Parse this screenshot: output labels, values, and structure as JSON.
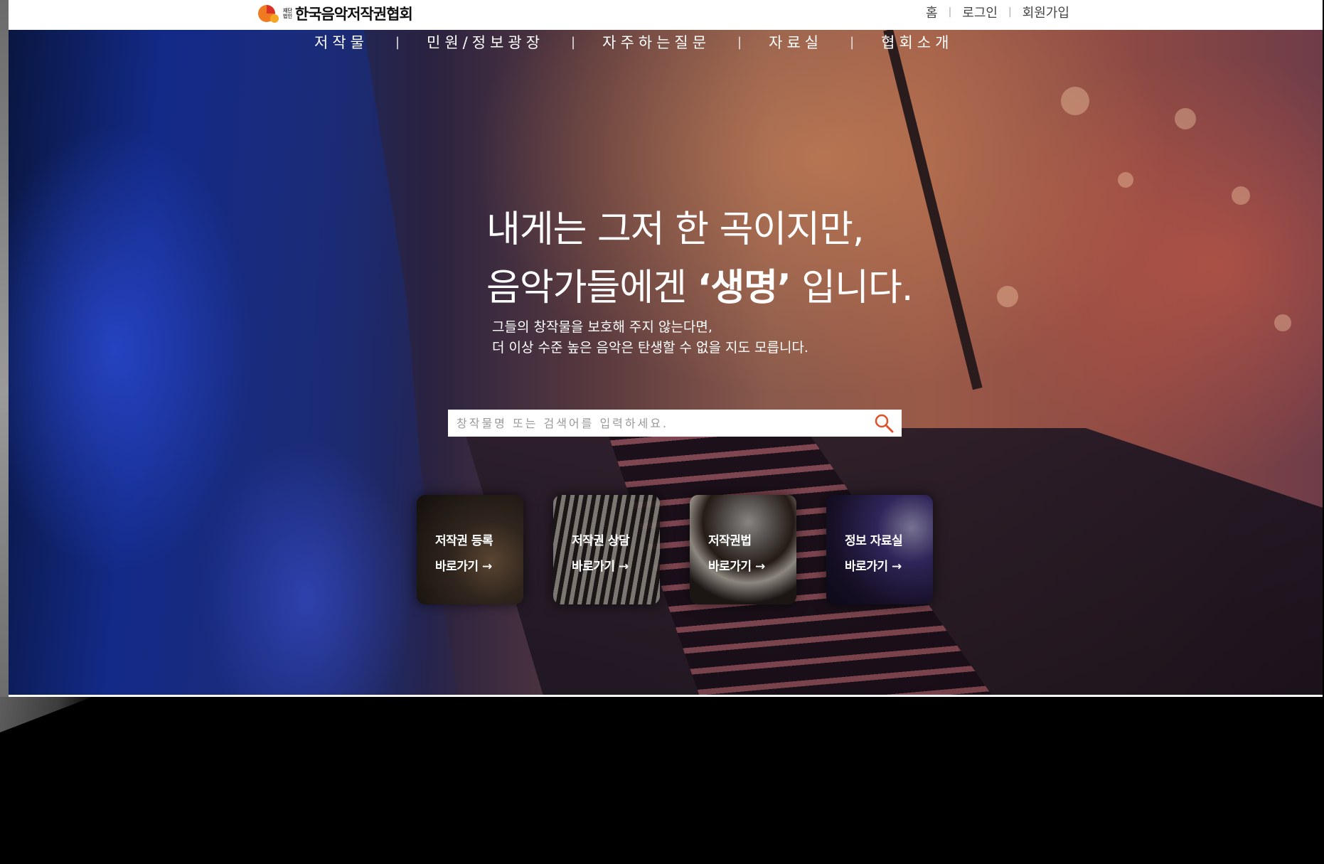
{
  "site": {
    "logo_small_1": "재단",
    "logo_small_2": "법인",
    "name": "한국음악저작권협회"
  },
  "utility": [
    {
      "label": "홈"
    },
    {
      "label": "로그인"
    },
    {
      "label": "회원가입"
    }
  ],
  "nav": [
    {
      "label": "저작물"
    },
    {
      "label": "민원/정보광장"
    },
    {
      "label": "자주하는질문"
    },
    {
      "label": "자료실"
    },
    {
      "label": "협회소개"
    }
  ],
  "nav_separator": "|",
  "hero": {
    "line1": "내게는 그저 한 곡이지만,",
    "line2_pre": "음악가들에겐 ",
    "line2_highlight": "‘생명’",
    "line2_post": " 입니다.",
    "sub1": "그들의 창작물을 보호해 주지 않는다면,",
    "sub2": "더 이상 수준 높은 음악은 탄생할 수 없을 지도 모릅니다."
  },
  "search": {
    "placeholder": "창작물명 또는 검색어를 입력하세요.",
    "icon": "search-icon",
    "icon_color": "#e0502a"
  },
  "cards": [
    {
      "title": "저작권 등록",
      "link": "바로가기 →",
      "image": "guitar"
    },
    {
      "title": "저작권 상담",
      "link": "바로가기 →",
      "image": "piano"
    },
    {
      "title": "저작권법",
      "link": "바로가기 →",
      "image": "drums"
    },
    {
      "title": "정보 자료실",
      "link": "바로가기 →",
      "image": "concert"
    }
  ],
  "colors": {
    "logo_orange": "#f07a1f",
    "logo_red": "#d9302a",
    "background": "#000000"
  }
}
